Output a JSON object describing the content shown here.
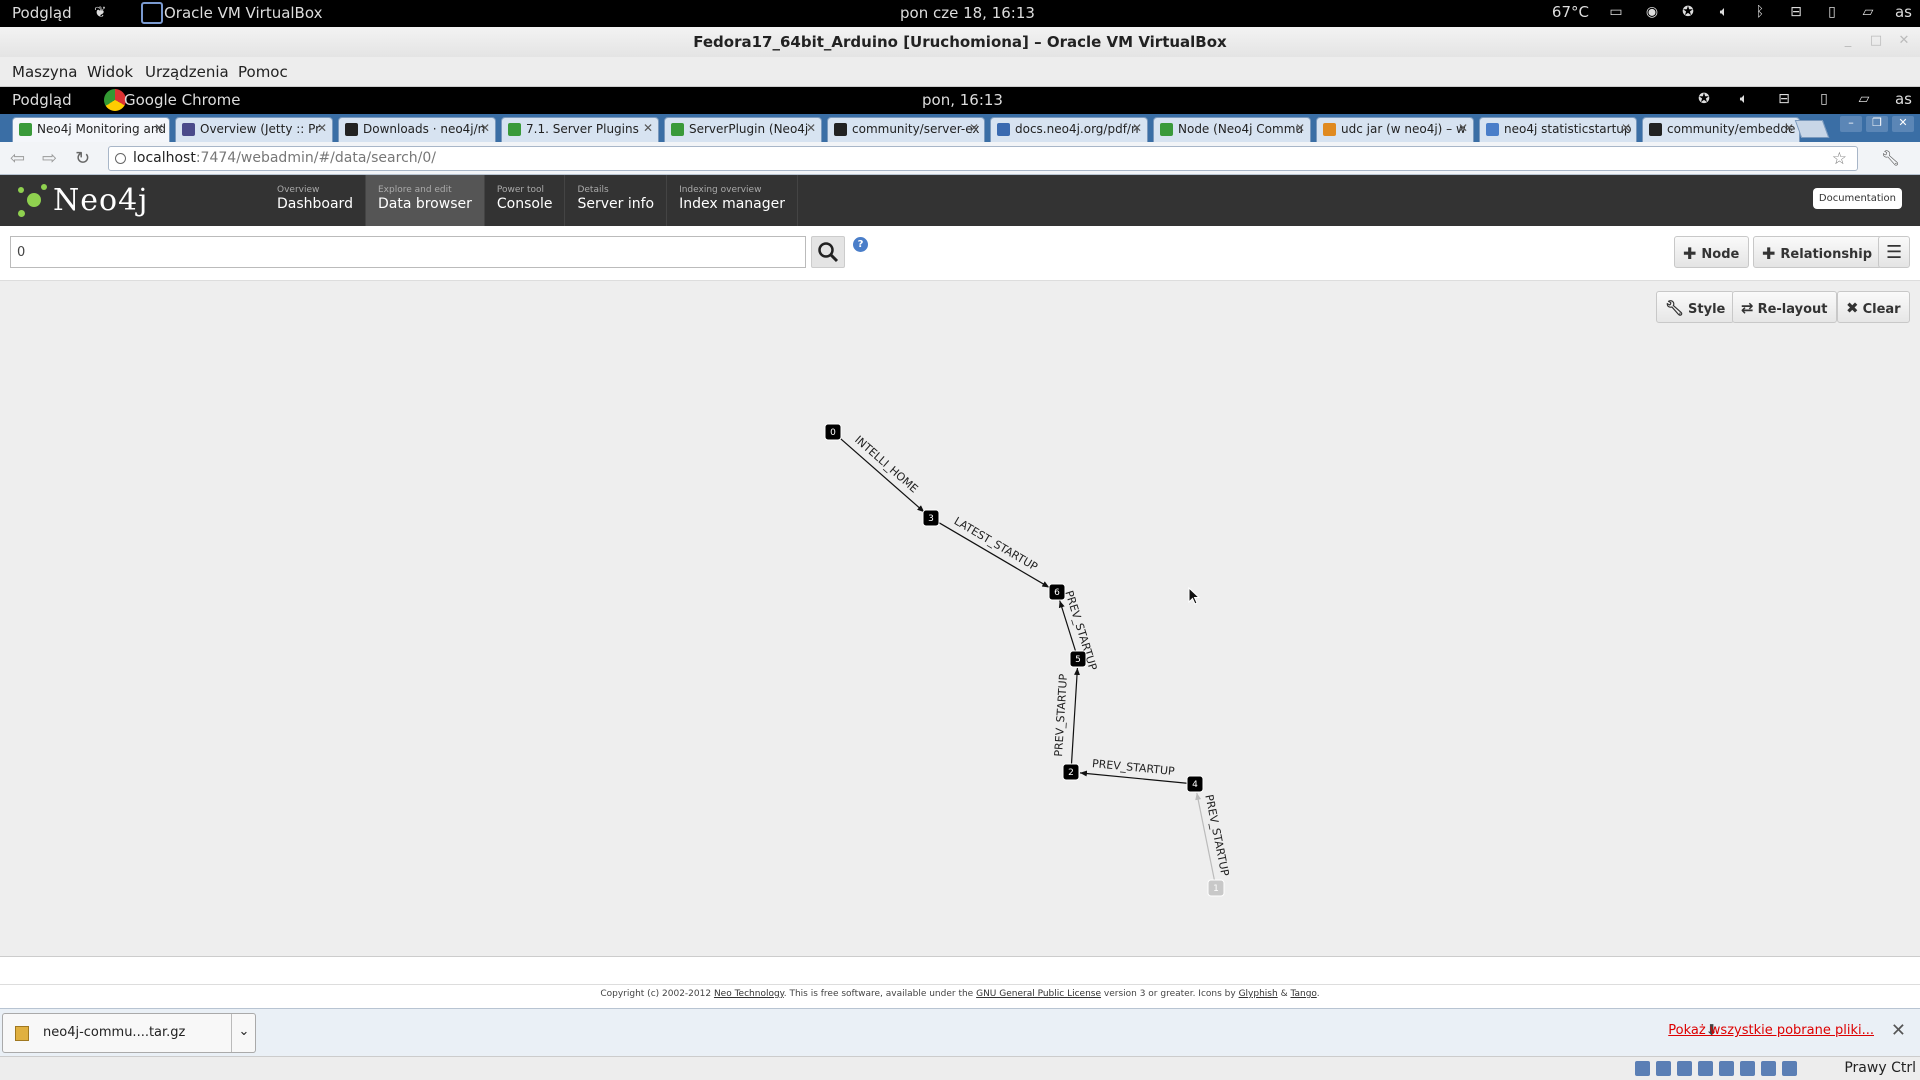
{
  "host_bar": {
    "activities": "Podgląd",
    "app_name": "Oracle VM VirtualBox",
    "clock": "pon cze 18, 16:13",
    "temp": "67°C",
    "user": "as"
  },
  "vbox": {
    "title": "Fedora17_64bit_Arduino [Uruchomiona] – Oracle VM VirtualBox",
    "menu": [
      "Maszyna",
      "Widok",
      "Urządzenia",
      "Pomoc"
    ],
    "host_key": "Prawy Ctrl"
  },
  "guest_bar": {
    "activities": "Podgląd",
    "app_name": "Google Chrome",
    "clock": "pon, 16:13",
    "user": "as"
  },
  "browser": {
    "tabs": [
      {
        "label": "Neo4j Monitoring and",
        "icon_color": "#3a9a3a"
      },
      {
        "label": "Overview (Jetty :: Pr",
        "icon_color": "#4a4a8a"
      },
      {
        "label": "Downloads · neo4j/n",
        "icon_color": "#222222"
      },
      {
        "label": "7.1. Server Plugins",
        "icon_color": "#3a9a3a"
      },
      {
        "label": "ServerPlugin (Neo4j",
        "icon_color": "#3a9a3a"
      },
      {
        "label": "community/server-ex",
        "icon_color": "#222222"
      },
      {
        "label": "docs.neo4j.org/pdf/n",
        "icon_color": "#3a6ab0"
      },
      {
        "label": "Node (Neo4j Commu",
        "icon_color": "#3a9a3a"
      },
      {
        "label": "udc jar (w neo4j) – w",
        "icon_color": "#e08a20"
      },
      {
        "label": "neo4j statisticstartup",
        "icon_color": "#4a7ec9"
      },
      {
        "label": "community/embedde",
        "icon_color": "#222222"
      }
    ],
    "url_host": "localhost",
    "url_path": ":7474/webadmin/#/data/search/0/"
  },
  "neo4j": {
    "logo_text": "Neo4j",
    "nav": [
      {
        "small": "Overview",
        "label": "Dashboard"
      },
      {
        "small": "Explore and edit",
        "label": "Data browser"
      },
      {
        "small": "Power tool",
        "label": "Console"
      },
      {
        "small": "Details",
        "label": "Server info"
      },
      {
        "small": "Indexing overview",
        "label": "Index manager"
      }
    ],
    "documentation_label": "Documentation",
    "search_value": "0",
    "buttons": {
      "node": "Node",
      "relationship": "Relationship"
    },
    "graph_buttons": {
      "style": "Style",
      "relayout": "Re-layout",
      "clear": "Clear"
    }
  },
  "graph": {
    "nodes": [
      {
        "id": "0",
        "faded": false
      },
      {
        "id": "3",
        "faded": false
      },
      {
        "id": "6",
        "faded": false
      },
      {
        "id": "5",
        "faded": false
      },
      {
        "id": "2",
        "faded": false
      },
      {
        "id": "4",
        "faded": false
      },
      {
        "id": "1",
        "faded": true
      }
    ],
    "relationships": [
      {
        "from": "0",
        "to": "3",
        "type": "INTELLI_HOME"
      },
      {
        "from": "3",
        "to": "6",
        "type": "LATEST_STARTUP"
      },
      {
        "from": "5",
        "to": "6",
        "type": "PREV_STARTUP"
      },
      {
        "from": "2",
        "to": "5",
        "type": "PREV_STARTUP"
      },
      {
        "from": "4",
        "to": "2",
        "type": "PREV_STARTUP"
      },
      {
        "from": "1",
        "to": "4",
        "type": "PREV_STARTUP"
      }
    ]
  },
  "footer": {
    "prefix": "Copyright (c) 2002-2012",
    "company": "Neo Technology",
    "middle": ". This is free software, available under the",
    "license": "GNU General Public License",
    "suffix": "version 3 or greater. Icons by",
    "glyphish": "Glyphish",
    "and": "&",
    "tango": "Tango",
    "end": "."
  },
  "downloads": {
    "file": "neo4j-commu....tar.gz",
    "show_all": "Pokaż wszystkie pobrane pliki..."
  }
}
